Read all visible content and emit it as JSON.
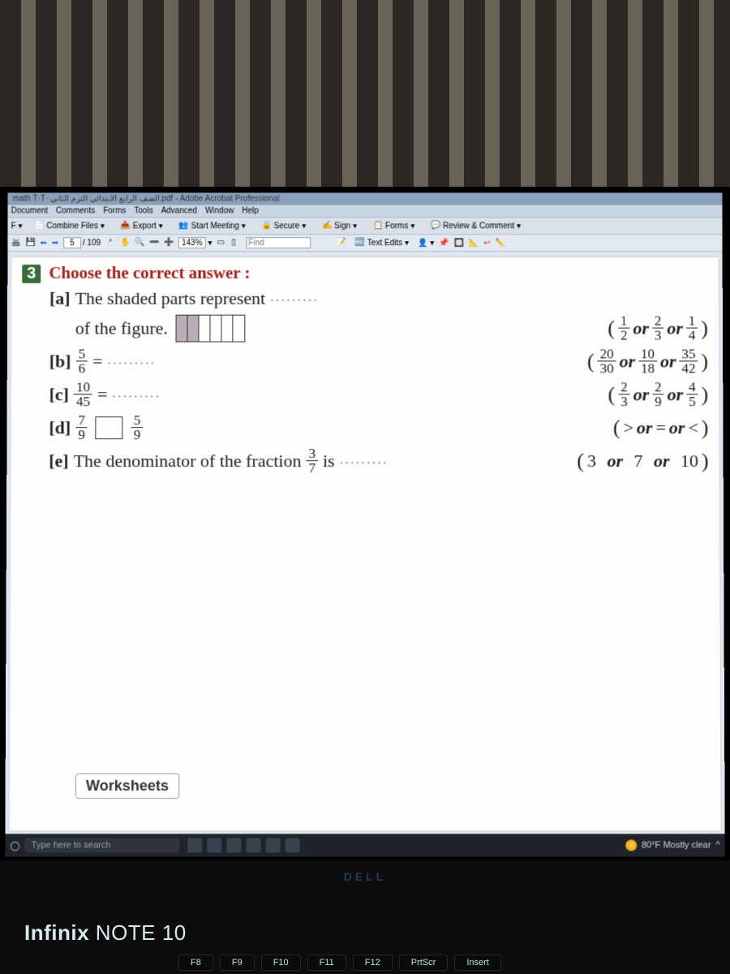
{
  "app": {
    "title": "math T·T· الصف الرابع الابتدائي الترم الثاني.pdf - Adobe Acrobat Professional",
    "menus": [
      "Document",
      "Comments",
      "Forms",
      "Tools",
      "Advanced",
      "Window",
      "Help"
    ],
    "toolbar1": {
      "combine": "Combine Files",
      "export": "Export",
      "start_meeting": "Start Meeting",
      "secure": "Secure",
      "sign": "Sign",
      "forms": "Forms",
      "review": "Review & Comment"
    },
    "toolbar2": {
      "page_current": "5",
      "page_total": "/ 109",
      "zoom": "143%",
      "find_placeholder": "Find",
      "text_edits": "Text Edits"
    }
  },
  "doc": {
    "qnum": "3",
    "heading": "Choose the correct answer :",
    "a_prefix": "[a]",
    "a_text1": "The shaded parts represent",
    "a_text2": "of the figure.",
    "a_opts": {
      "o1n": "1",
      "o1d": "2",
      "o2n": "2",
      "o2d": "3",
      "o3n": "1",
      "o3d": "4"
    },
    "b_prefix": "[b]",
    "b_fracn": "5",
    "b_fracd": "6",
    "b_eq": "=",
    "b_opts": {
      "o1n": "20",
      "o1d": "30",
      "o2n": "10",
      "o2d": "18",
      "o3n": "35",
      "o3d": "42"
    },
    "c_prefix": "[c]",
    "c_fracn": "10",
    "c_fracd": "45",
    "c_eq": "=",
    "c_opts": {
      "o1n": "2",
      "o1d": "3",
      "o2n": "2",
      "o2d": "9",
      "o3n": "4",
      "o3d": "5"
    },
    "d_prefix": "[d]",
    "d_f1n": "7",
    "d_f1d": "9",
    "d_f2n": "5",
    "d_f2d": "9",
    "d_opts": {
      "o1": ">",
      "o2": "=",
      "o3": "<"
    },
    "e_prefix": "[e]",
    "e_text": "The denominator of the fraction",
    "e_fracn": "3",
    "e_fracd": "7",
    "e_is": "is",
    "e_opts": {
      "o1": "3",
      "o2": "7",
      "o3": "10"
    },
    "or": "or",
    "ws_tab": "Worksheets"
  },
  "taskbar": {
    "search": "Type here to search",
    "weather": "80°F Mostly clear"
  },
  "laptop": {
    "brand1": "Infinix",
    "brand2": "NOTE 10",
    "dell": "DELL",
    "keys": [
      "F8",
      "F9",
      "F10",
      "F11",
      "F12",
      "PrtScr",
      "Insert"
    ]
  }
}
